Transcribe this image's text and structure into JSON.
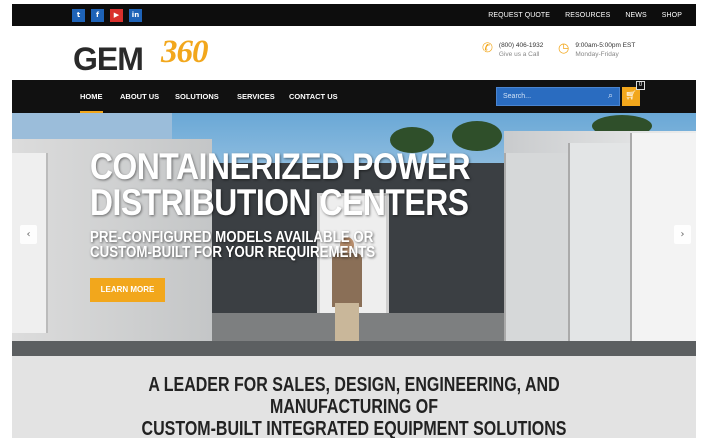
{
  "topbar": {
    "social": [
      {
        "icon": "twitter-icon",
        "glyph": "t",
        "color": "#1e63b8"
      },
      {
        "icon": "facebook-icon",
        "glyph": "f",
        "color": "#1e63b8"
      },
      {
        "icon": "youtube-icon",
        "glyph": "▶",
        "color": "#d9302c"
      },
      {
        "icon": "linkedin-icon",
        "glyph": "in",
        "color": "#1e63b8"
      }
    ],
    "links": [
      "REQUEST QUOTE",
      "RESOURCES",
      "NEWS",
      "SHOP"
    ]
  },
  "header": {
    "logo_text": "GEM",
    "logo_accent": "360",
    "phone": {
      "number": "(800) 406-1932",
      "caption": "Give us a Call"
    },
    "hours": {
      "time": "9:00am-5:00pm EST",
      "days": "Monday-Friday"
    }
  },
  "nav": {
    "items": [
      "HOME",
      "ABOUT US",
      "SOLUTIONS",
      "SERVICES",
      "CONTACT US"
    ],
    "search_placeholder": "Search...",
    "cart_count": "0"
  },
  "hero": {
    "title_line1": "CONTAINERIZED POWER",
    "title_line2": "DISTRIBUTION CENTERS",
    "subtitle_line1": "PRE-CONFIGURED MODELS AVAILABLE OR",
    "subtitle_line2": "CUSTOM-BUILT FOR YOUR REQUIREMENTS",
    "cta": "LEARN MORE"
  },
  "tagline": {
    "line1": "A LEADER FOR SALES, DESIGN, ENGINEERING, AND MANUFACTURING OF",
    "line2": "CUSTOM-BUILT INTEGRATED EQUIPMENT SOLUTIONS"
  },
  "colors": {
    "accent": "#f2a71c",
    "nav_bg": "#111111",
    "search_bg": "#2a6cc0"
  }
}
